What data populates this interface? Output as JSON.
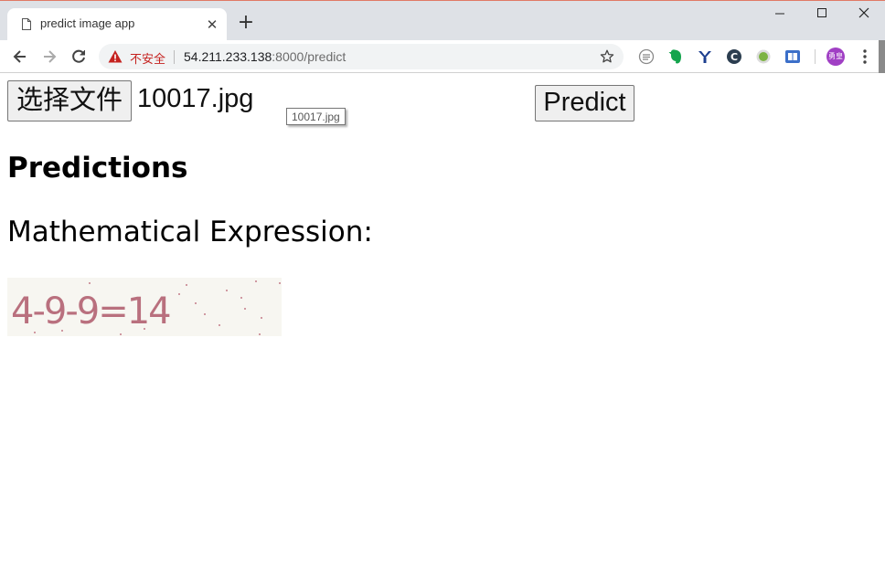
{
  "browser": {
    "tab_title": "predict image app",
    "tab_close": "✕",
    "new_tab": "+",
    "window_controls": {
      "minimize": "—",
      "maximize": "☐",
      "close": "✕"
    },
    "security_label": "不安全",
    "url_host": "54.211.233.138",
    "url_path": ":8000/predict",
    "avatar_text": "勇皇",
    "icons": [
      "back-icon",
      "forward-icon",
      "reload-icon",
      "warning-icon",
      "star-icon",
      "extension-icons",
      "profile-avatar",
      "menu-icon"
    ]
  },
  "page": {
    "file_button_label": "选择文件",
    "file_name": "10017.jpg",
    "tooltip_text": "10017.jpg",
    "predict_button_label": "Predict",
    "heading": "Predictions",
    "expression_label": "Mathematical Expression:",
    "captcha_text": "4-9-9=14"
  },
  "colors": {
    "chrome_bg": "#dee1e6",
    "insecure_red": "#c5221f",
    "captcha_ink": "#b9707e",
    "captcha_bg": "#f7f6f1",
    "avatar": "#a03fc4"
  }
}
